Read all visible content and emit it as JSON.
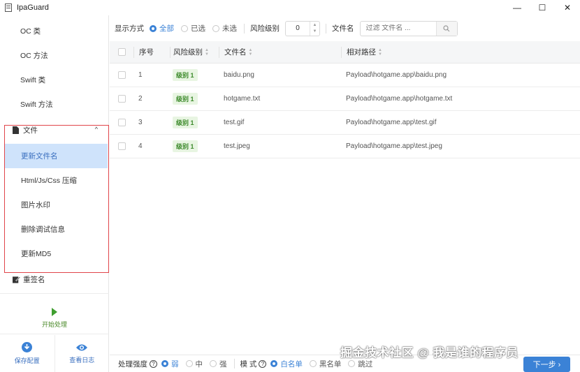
{
  "window": {
    "title": "IpaGuard",
    "minimize": "—",
    "maximize": "☐",
    "close": "✕"
  },
  "sidebar": {
    "items": [
      {
        "label": "OC 类"
      },
      {
        "label": "OC 方法"
      },
      {
        "label": "Swift 类"
      },
      {
        "label": "Swift 方法"
      }
    ],
    "file_group": {
      "label": "文件",
      "chevron": "^"
    },
    "file_items": [
      {
        "label": "更新文件名",
        "active": true
      },
      {
        "label": "Html/Js/Css 压缩"
      },
      {
        "label": "图片水印"
      },
      {
        "label": "删除调试信息"
      },
      {
        "label": "更新MD5"
      }
    ],
    "resign": {
      "label": "重签名"
    },
    "start_label": "开始处理",
    "save_label": "保存配置",
    "log_label": "查看日志"
  },
  "filter": {
    "display_mode_label": "显示方式",
    "options": [
      {
        "label": "全部",
        "selected": true
      },
      {
        "label": "已选",
        "selected": false
      },
      {
        "label": "未选",
        "selected": false
      }
    ],
    "risk_label": "风险级别",
    "risk_value": "0",
    "filename_label": "文件名",
    "search_placeholder": "过滤 文件名 ..."
  },
  "table": {
    "headers": {
      "idx": "序号",
      "level": "风险级别",
      "name": "文件名",
      "path": "相对路径"
    },
    "rows": [
      {
        "idx": "1",
        "level": "级别 1",
        "name": "baidu.png",
        "path": "Payload\\hotgame.app\\baidu.png"
      },
      {
        "idx": "2",
        "level": "级别 1",
        "name": "hotgame.txt",
        "path": "Payload\\hotgame.app\\hotgame.txt"
      },
      {
        "idx": "3",
        "level": "级别 1",
        "name": "test.gif",
        "path": "Payload\\hotgame.app\\test.gif"
      },
      {
        "idx": "4",
        "level": "级别 1",
        "name": "test.jpeg",
        "path": "Payload\\hotgame.app\\test.jpeg"
      }
    ]
  },
  "bottom": {
    "strength_label": "处理强度",
    "strength_options": [
      {
        "label": "弱",
        "selected": true
      },
      {
        "label": "中",
        "selected": false
      },
      {
        "label": "强",
        "selected": false
      }
    ],
    "mode_label": "模 式",
    "mode_options": [
      {
        "label": "白名单",
        "selected": true
      },
      {
        "label": "黑名单",
        "selected": false
      },
      {
        "label": "跳过",
        "selected": false
      }
    ],
    "next_label": "下一步 ›",
    "help_glyph": "?"
  },
  "watermark": "掘金技术社区 @ 我是谁的程序员",
  "colors": {
    "accent": "#3b82d6",
    "highlight_box": "#e0454a",
    "badge_bg": "#e8f5e2",
    "start_green": "#3f9e2f"
  }
}
